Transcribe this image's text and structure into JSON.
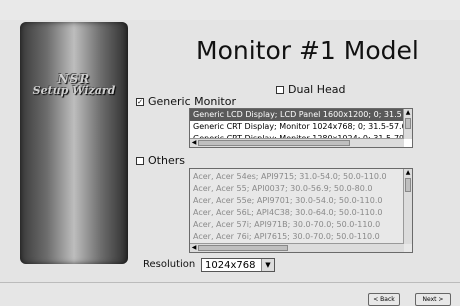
{
  "sidebar": {
    "brand_line1": "NSR",
    "brand_line2": "Setup Wizard"
  },
  "title": "Monitor #1 Model",
  "dual_head": {
    "label": "Dual Head",
    "checked": false
  },
  "generic_monitor": {
    "label": "Generic Monitor",
    "checked": true,
    "items": [
      "Generic LCD Display; LCD Panel 1600x1200; 0; 31.5",
      "Generic CRT Display; Monitor 1024x768; 0; 31.5-57.0",
      "Generic CRT Display; Monitor 1280x1024; 0; 31.5-79"
    ],
    "selected_index": 0
  },
  "others": {
    "label": "Others",
    "checked": false,
    "items": [
      "Acer, Acer 54es; API9715; 31.0-54.0; 50.0-110.0",
      "Acer, Acer 55; API0037; 30.0-56.9; 50.0-80.0",
      "Acer, Acer 55e; API9701; 30.0-54.0; 50.0-110.0",
      "Acer, Acer 56L; API4C38; 30.0-64.0; 50.0-110.0",
      "Acer, Acer 57i; API971B; 30.0-70.0; 50.0-110.0",
      "Acer, Acer 76i; API7615; 30.0-70.0; 50.0-110.0"
    ]
  },
  "resolution": {
    "label": "Resolution",
    "value": "1024x768"
  },
  "buttons": {
    "back": "< Back",
    "next": "Next >"
  }
}
